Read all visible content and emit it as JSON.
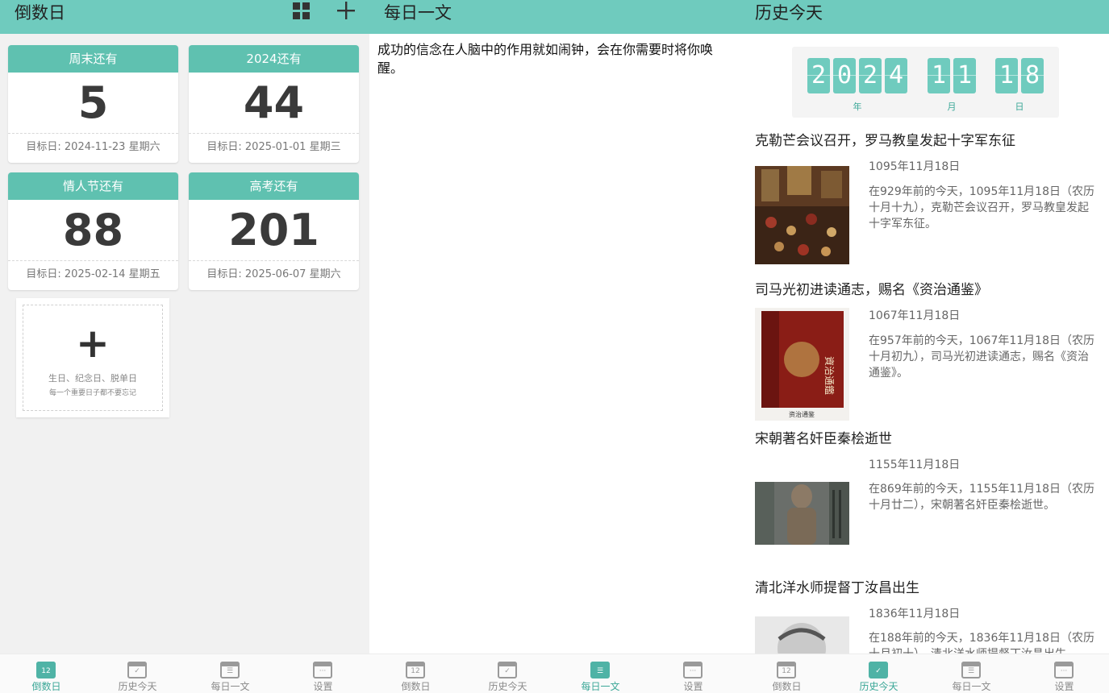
{
  "countdown": {
    "title": "倒数日",
    "cards": [
      {
        "label": "周末还有",
        "days": "5",
        "target": "目标日: 2024-11-23 星期六"
      },
      {
        "label": "2024还有",
        "days": "44",
        "target": "目标日: 2025-01-01 星期三"
      },
      {
        "label": "情人节还有",
        "days": "88",
        "target": "目标日: 2025-02-14 星期五"
      },
      {
        "label": "高考还有",
        "days": "201",
        "target": "目标日: 2025-06-07 星期六"
      }
    ],
    "add_card": {
      "plus": "+",
      "line1": "生日、纪念日、脱单日",
      "line2": "每一个重要日子都不要忘记"
    }
  },
  "daily": {
    "title": "每日一文",
    "quote": "成功的信念在人脑中的作用就如闹钟，会在你需要时将你唤醒。"
  },
  "history": {
    "title": "历史今天",
    "digits": [
      "2",
      "0",
      "2",
      "4",
      "1",
      "1",
      "1",
      "8"
    ],
    "units": {
      "year": "年",
      "month": "月",
      "day": "日"
    },
    "events": [
      {
        "title": "克勒芒会议召开，罗马教皇发起十字军东征",
        "date": "1095年11月18日",
        "desc": "在929年前的今天，1095年11月18日（农历十月十九），克勒芒会议召开，罗马教皇发起十字军东征。"
      },
      {
        "title": "司马光初进读通志，赐名《资治通鉴》",
        "date": "1067年11月18日",
        "desc": "在957年前的今天，1067年11月18日（农历十月初九），司马光初进读通志，赐名《资治通鉴》。",
        "book_spine_text": "资治通鉴"
      },
      {
        "title": "宋朝著名奸臣秦桧逝世",
        "date": "1155年11月18日",
        "desc": "在869年前的今天，1155年11月18日（农历十月廿二），宋朝著名奸臣秦桧逝世。"
      },
      {
        "title": "清北洋水师提督丁汝昌出生",
        "date": "1836年11月18日",
        "desc": "在188年前的今天，1836年11月18日（农历十月初十），清北洋水师提督丁汝昌出生。"
      }
    ]
  },
  "nav": {
    "items": [
      "倒数日",
      "历史今天",
      "每日一文",
      "设置"
    ],
    "calendar_glyph": "12"
  },
  "colors": {
    "accent": "#6fcbbe",
    "accent_dark": "#4fb3a6"
  }
}
